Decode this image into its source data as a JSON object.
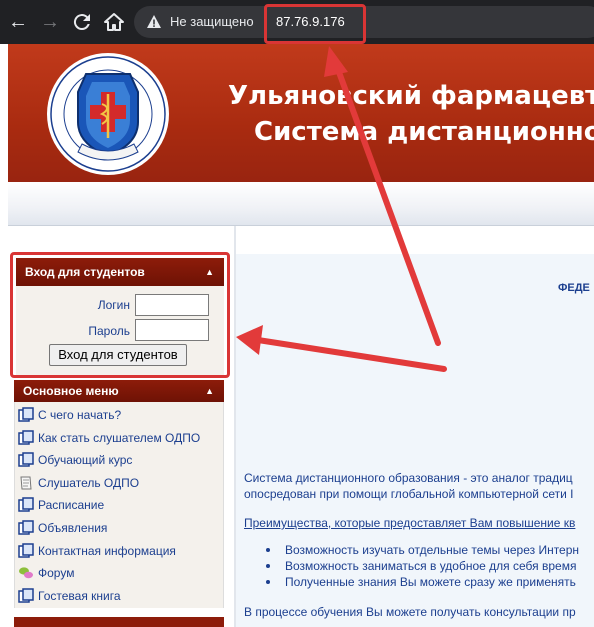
{
  "browser": {
    "security_label": "Не защищено",
    "url": "87.76.9.176"
  },
  "header": {
    "title_line1": "Ульяновский фармацевти",
    "title_line2": "Система дистанционно"
  },
  "login": {
    "title": "Вход для студентов",
    "login_label": "Логин",
    "password_label": "Пароль",
    "submit_label": "Вход для студентов"
  },
  "menu": {
    "title": "Основное меню",
    "items": [
      {
        "label": "С чего начать?",
        "icon": "document-icon"
      },
      {
        "label": "Как стать слушателем ОДПО",
        "icon": "document-icon"
      },
      {
        "label": "Обучающий курс",
        "icon": "document-icon"
      },
      {
        "label": "Слушатель ОДПО",
        "icon": "notepad-icon"
      },
      {
        "label": "Расписание",
        "icon": "document-icon"
      },
      {
        "label": "Объявления",
        "icon": "document-icon"
      },
      {
        "label": "Контактная информация",
        "icon": "document-icon"
      },
      {
        "label": "Форум",
        "icon": "forum-icon"
      },
      {
        "label": "Гостевая книга",
        "icon": "document-icon"
      }
    ]
  },
  "main": {
    "heading": "ФЕДЕ",
    "para1_line1": "Система дистанционного образования - это аналог традиц",
    "para1_line2": "опосредован при помощи глобальной компьютерной сети I",
    "advantages_link": "Преимущества, которые предоставляет Вам повышение кв",
    "bullets": [
      "Возможность изучать отдельные темы через Интерн",
      "Возможность заниматься в удобное для себя время",
      "Полученные знания Вы можете сразу же применять"
    ],
    "para2": "В процессе обучения Вы можете получать консультации пр"
  },
  "colors": {
    "header_red": "#a92b10",
    "block_head": "#8d1c0a",
    "link_blue": "#1c3f8f",
    "annotation_red": "#d93535"
  }
}
